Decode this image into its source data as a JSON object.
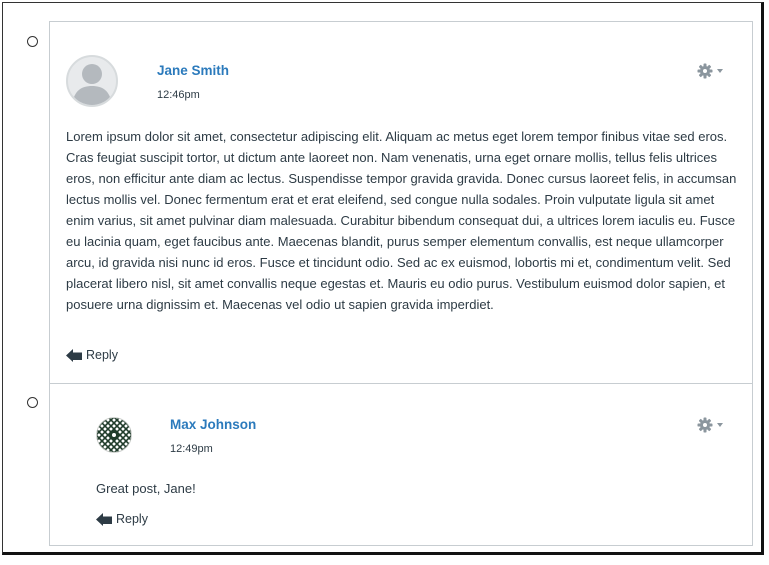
{
  "entries": [
    {
      "author": "Jane Smith",
      "time": "12:46pm",
      "body": "Lorem ipsum dolor sit amet, consectetur adipiscing elit. Aliquam ac metus eget lorem tempor finibus vitae sed eros. Cras feugiat suscipit tortor, ut dictum ante laoreet non. Nam venenatis, urna eget ornare mollis, tellus felis ultrices eros, non efficitur ante diam ac lectus. Suspendisse tempor gravida gravida. Donec cursus laoreet felis, in accumsan lectus mollis vel. Donec fermentum erat et erat eleifend, sed congue nulla sodales. Proin vulputate ligula sit amet enim varius, sit amet pulvinar diam malesuada. Curabitur bibendum consequat dui, a ultrices lorem iaculis eu. Fusce eu lacinia quam, eget faucibus ante. Maecenas blandit, purus semper elementum convallis, est neque ullamcorper arcu, id gravida nisi nunc id eros. Fusce et tincidunt odio. Sed ac ex euismod, lobortis mi et, condimentum velit. Sed placerat libero nisl, sit amet convallis neque egestas et. Mauris eu odio purus. Vestibulum euismod dolor sapien, et posuere urna dignissim et. Maecenas vel odio ut sapien gravida imperdiet.",
      "reply_label": "Reply",
      "avatar_icon": "default-person-avatar",
      "menu_icon": "gear-icon"
    },
    {
      "author": "Max Johnson",
      "time": "12:49pm",
      "body": "Great post, Jane!",
      "reply_label": "Reply",
      "avatar_icon": "pattern-avatar",
      "menu_icon": "gear-icon"
    }
  ],
  "colors": {
    "author_link": "#2b7abc",
    "text": "#2d3b45",
    "border": "#c7cdd1",
    "gear": "#8b969e"
  }
}
